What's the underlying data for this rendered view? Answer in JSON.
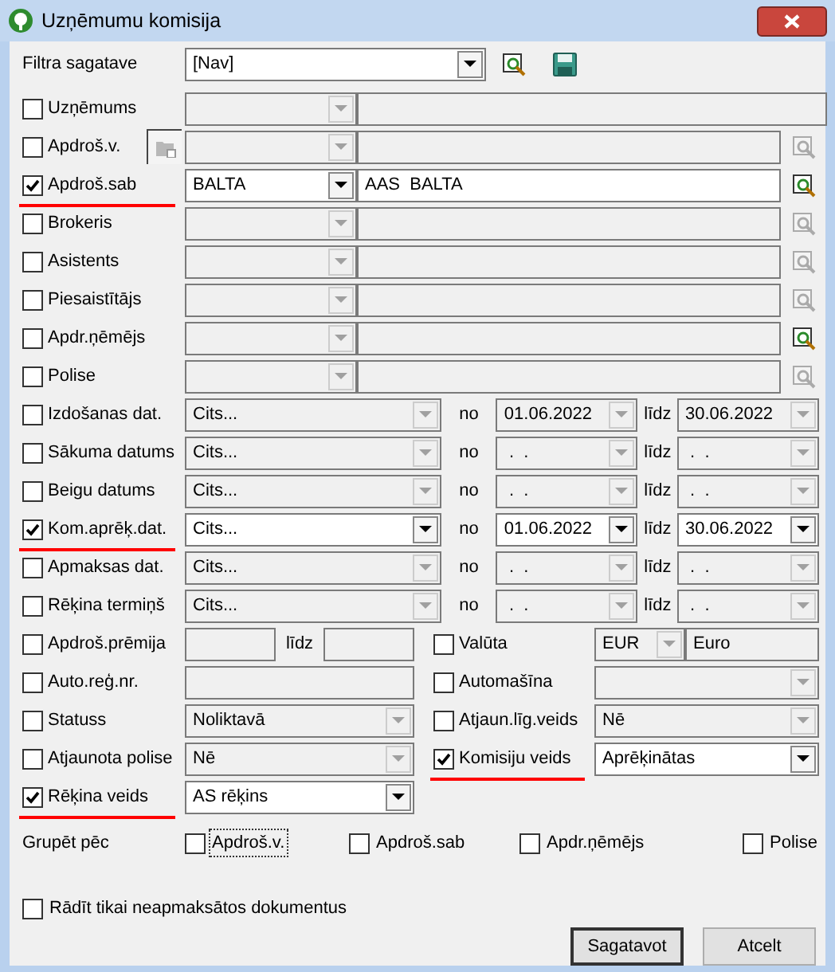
{
  "window": {
    "title": "Uzņēmumu komisija"
  },
  "filter": {
    "label": "Filtra sagatave",
    "value": "[Nav]"
  },
  "rows": [
    {
      "kind": "company",
      "label": "Uzņēmums",
      "checked": false,
      "marked": false,
      "active": false
    },
    {
      "kind": "entity",
      "label": "Apdroš.v.",
      "checked": false,
      "marked": false,
      "active": false,
      "lookup_enabled": false,
      "extra_button": true
    },
    {
      "kind": "entity",
      "label": "Apdroš.sab",
      "checked": true,
      "marked": true,
      "active": true,
      "code": "BALTA",
      "name": "AAS  BALTA",
      "lookup_enabled": true,
      "extra_button": false
    },
    {
      "kind": "entity",
      "label": "Brokeris",
      "checked": false,
      "marked": false,
      "active": false,
      "lookup_enabled": false,
      "extra_button": false
    },
    {
      "kind": "entity",
      "label": "Asistents",
      "checked": false,
      "marked": false,
      "active": false,
      "lookup_enabled": false,
      "extra_button": false
    },
    {
      "kind": "entity",
      "label": "Piesaistītājs",
      "checked": false,
      "marked": false,
      "active": false,
      "lookup_enabled": false,
      "extra_button": false
    },
    {
      "kind": "entity",
      "label": "Apdr.ņēmējs",
      "checked": false,
      "marked": false,
      "active": false,
      "lookup_enabled": true,
      "extra_button": false
    },
    {
      "kind": "entity",
      "label": "Polise",
      "checked": false,
      "marked": false,
      "active": false,
      "lookup_enabled": false,
      "extra_button": false
    },
    {
      "kind": "date",
      "label": "Izdošanas dat.",
      "checked": false,
      "marked": false,
      "active": false,
      "period": "Cits...",
      "from_label": "no",
      "from": "01.06.2022",
      "to_label": "līdz",
      "to": "30.06.2022"
    },
    {
      "kind": "date",
      "label": "Sākuma datums",
      "checked": false,
      "marked": false,
      "active": false,
      "period": "Cits...",
      "from_label": "no",
      "from": " .  .",
      "to_label": "līdz",
      "to": " .  ."
    },
    {
      "kind": "date",
      "label": "Beigu datums",
      "checked": false,
      "marked": false,
      "active": false,
      "period": "Cits...",
      "from_label": "no",
      "from": " .  .",
      "to_label": "līdz",
      "to": " .  ."
    },
    {
      "kind": "date",
      "label": "Kom.aprēķ.dat.",
      "checked": true,
      "marked": true,
      "active": true,
      "period": "Cits...",
      "from_label": "no",
      "from": "01.06.2022",
      "to_label": "līdz",
      "to": "30.06.2022"
    },
    {
      "kind": "date",
      "label": "Apmaksas dat.",
      "checked": false,
      "marked": false,
      "active": false,
      "period": "Cits...",
      "from_label": "no",
      "from": " .  .",
      "to_label": "līdz",
      "to": " .  ."
    },
    {
      "kind": "date",
      "label": "Rēķina termiņš",
      "checked": false,
      "marked": false,
      "active": false,
      "period": "Cits...",
      "from_label": "no",
      "from": " .  .",
      "to_label": "līdz",
      "to": " .  ."
    }
  ],
  "pairs": [
    {
      "left": {
        "kind": "range",
        "label": "Apdroš.prēmija",
        "checked": false,
        "marked": false,
        "active": false,
        "middle": "līdz"
      },
      "right": {
        "kind": "currency",
        "label": "Valūta",
        "checked": false,
        "marked": false,
        "active": false,
        "code": "EUR",
        "name": "Euro"
      }
    },
    {
      "left": {
        "kind": "text",
        "label": "Auto.reģ.nr.",
        "checked": false,
        "marked": false,
        "active": false
      },
      "right": {
        "kind": "select",
        "label": "Automašīna",
        "checked": false,
        "marked": false,
        "active": false
      }
    },
    {
      "left": {
        "kind": "select",
        "label": "Statuss",
        "checked": false,
        "marked": false,
        "active": false,
        "value": "Noliktavā"
      },
      "right": {
        "kind": "select",
        "label": "Atjaun.līg.veids",
        "checked": false,
        "marked": false,
        "active": false,
        "value": "Nē"
      }
    },
    {
      "left": {
        "kind": "select",
        "label": "Atjaunota polise",
        "checked": false,
        "marked": false,
        "active": false,
        "value": "Nē"
      },
      "right": {
        "kind": "select",
        "label": "Komisiju veids",
        "checked": true,
        "marked": true,
        "active": true,
        "value": "Aprēķinātas"
      }
    },
    {
      "left": {
        "kind": "select",
        "label": "Rēķina veids",
        "checked": true,
        "marked": true,
        "active": true,
        "value": "AS rēķins"
      }
    }
  ],
  "group_by": {
    "label": "Grupēt pēc",
    "options": [
      {
        "label": "Apdroš.v.",
        "checked": false,
        "focused": true
      },
      {
        "label": "Apdroš.sab",
        "checked": false,
        "focused": false
      },
      {
        "label": "Apdr.ņēmējs",
        "checked": false,
        "focused": false
      },
      {
        "label": "Polise",
        "checked": false,
        "focused": false
      }
    ]
  },
  "unpaid_only": {
    "label": "Rādīt tikai neapmaksātos dokumentus",
    "checked": false
  },
  "buttons": [
    {
      "label": "Sagatavot",
      "default": true
    },
    {
      "label": "Atcelt",
      "default": false
    }
  ]
}
